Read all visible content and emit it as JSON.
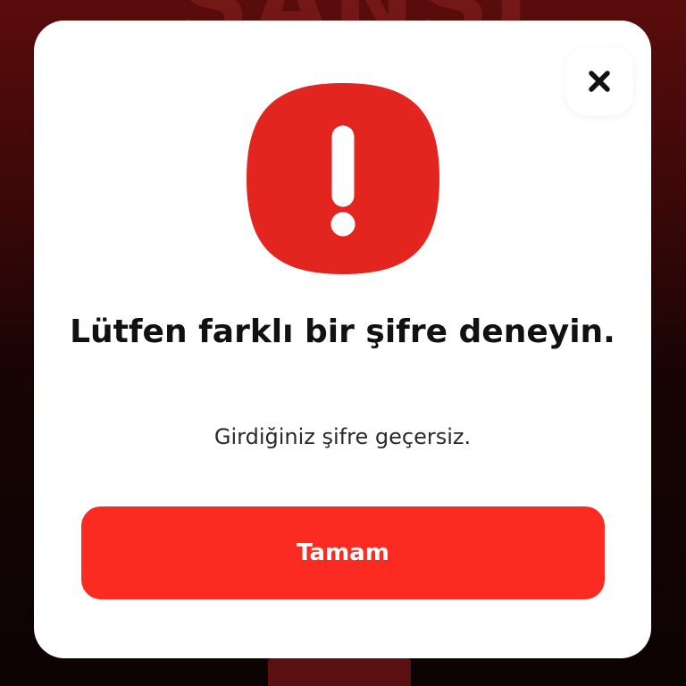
{
  "background": {
    "brand_text": "ŞANSI"
  },
  "dialog": {
    "title": "Lütfen farklı bir şifre deneyin.",
    "message": "Girdiğiniz şifre geçersiz.",
    "ok_label": "Tamam",
    "close_icon": "close-icon",
    "alert_icon": "exclamation-alert-icon"
  },
  "colors": {
    "accent": "#fb2b22",
    "alert_icon_bg": "#e2261f",
    "modal_bg": "#ffffff",
    "title_text": "#111111"
  }
}
